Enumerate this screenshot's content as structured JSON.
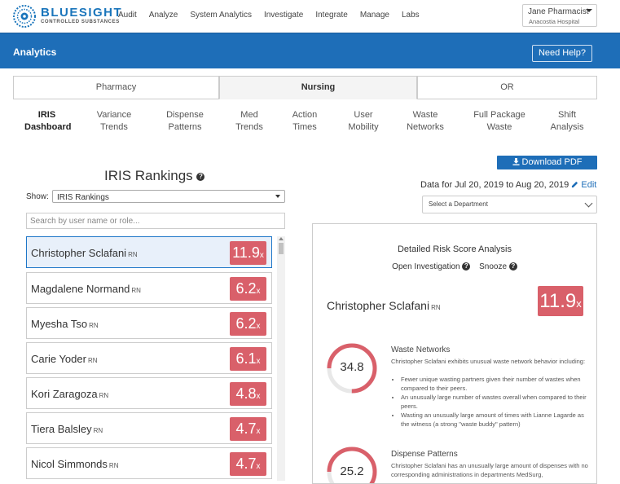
{
  "brand": {
    "name_part1": "BLUE",
    "name_part2": "SIGHT",
    "subtitle": "CONTROLLED SUBSTANCES",
    "accent": "#1e6eb8"
  },
  "nav": {
    "links": [
      "Audit",
      "Analyze",
      "System Analytics",
      "Investigate",
      "Integrate",
      "Manage",
      "Labs"
    ]
  },
  "user": {
    "name": "Jane Pharmacist",
    "hospital": "Anacostia Hospital"
  },
  "analytics": {
    "title": "Analytics",
    "help_label": "Need Help?"
  },
  "tabs": [
    "Pharmacy",
    "Nursing",
    "OR"
  ],
  "active_tab": "Nursing",
  "subnav": [
    {
      "line1": "IRIS",
      "line2": "Dashboard"
    },
    {
      "line1": "Variance",
      "line2": "Trends"
    },
    {
      "line1": "Dispense",
      "line2": "Patterns"
    },
    {
      "line1": "Med",
      "line2": "Trends"
    },
    {
      "line1": "Action",
      "line2": "Times"
    },
    {
      "line1": "User",
      "line2": "Mobility"
    },
    {
      "line1": "Waste",
      "line2": "Networks"
    },
    {
      "line1": "Full Package",
      "line2": "Waste"
    },
    {
      "line1": "Shift",
      "line2": "Analysis"
    }
  ],
  "rankings": {
    "title": "IRIS Rankings",
    "help_icon": "?",
    "show_label": "Show:",
    "show_value": "IRIS Rankings",
    "search_placeholder": "Search by user name or role...",
    "items": [
      {
        "name": "Christopher Sclafani",
        "role": "RN",
        "score": "11.9",
        "suffix": "x"
      },
      {
        "name": "Magdalene Normand",
        "role": "RN",
        "score": "6.2",
        "suffix": "x"
      },
      {
        "name": "Myesha Tso",
        "role": "RN",
        "score": "6.2",
        "suffix": "x"
      },
      {
        "name": "Carie Yoder",
        "role": "RN",
        "score": "6.1",
        "suffix": "x"
      },
      {
        "name": "Kori Zaragoza",
        "role": "RN",
        "score": "4.8",
        "suffix": "x"
      },
      {
        "name": "Tiera Balsley",
        "role": "RN",
        "score": "4.7",
        "suffix": "x"
      },
      {
        "name": "Nicol Simmonds",
        "role": "RN",
        "score": "4.7",
        "suffix": "x"
      }
    ],
    "score_color": "#d9606a"
  },
  "right": {
    "download_label": "Download PDF",
    "date_range": "Data for Jul 20, 2019 to Aug 20, 2019",
    "edit_label": "Edit",
    "department_placeholder": "Select a Department",
    "detail": {
      "title": "Detailed Risk Score Analysis",
      "open_investigation": "Open Investigation",
      "snooze": "Snooze",
      "help_icon": "?",
      "user_name": "Christopher Sclafani",
      "user_role": "RN",
      "score": "11.9",
      "suffix": "x",
      "metrics": [
        {
          "title": "Waste Networks",
          "value": "34.8",
          "gauge_fraction": 0.75,
          "description": "Christopher Sclafani exhibits unusual waste network behavior including:",
          "bullets": [
            "Fewer unique wasting partners given their number of wastes when compared to their peers.",
            "An unusually large number of wastes overall when compared to their peers.",
            "Wasting an unusually large amount of times with Lianne Lagarde as the witness (a strong \"waste buddy\" pattern)"
          ]
        },
        {
          "title": "Dispense Patterns",
          "value": "25.2",
          "gauge_fraction": 0.75,
          "description": "Christopher Sclafani has an unusually large amount of dispenses with no corresponding administrations in departments MedSurg,",
          "bullets": []
        }
      ]
    }
  }
}
